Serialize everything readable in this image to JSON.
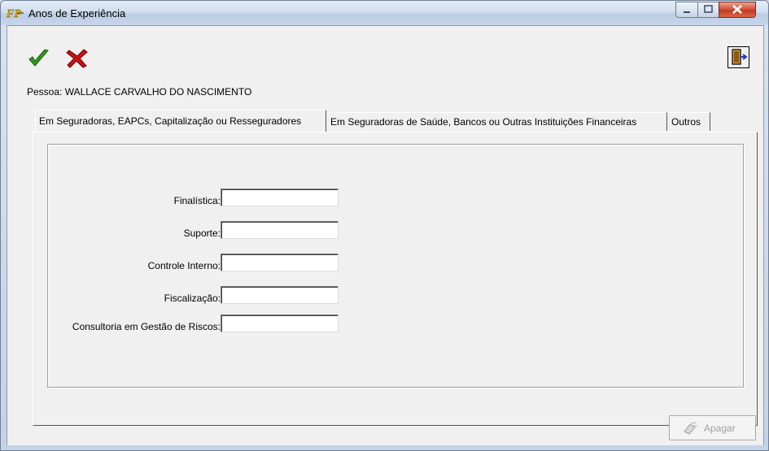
{
  "window": {
    "title": "Anos de Experiência",
    "app_icon": "fp-logo-icon",
    "controls": [
      "minimize-icon",
      "maximize-icon",
      "close-icon"
    ]
  },
  "toolbar": {
    "confirm_icon": "checkmark-icon",
    "cancel_icon": "red-x-icon",
    "exit_icon": "exit-door-icon"
  },
  "person": {
    "text": "Pessoa: WALLACE CARVALHO DO NASCIMENTO"
  },
  "tabs": [
    {
      "label": "Em Seguradoras, EAPCs, Capitalização ou Resseguradores",
      "active": true
    },
    {
      "label": "Em Seguradoras de Saúde, Bancos ou Outras Instituições Financeiras",
      "active": false
    },
    {
      "label": "Outros",
      "active": false
    }
  ],
  "fields": [
    {
      "label": "Finalística:",
      "value": ""
    },
    {
      "label": "Suporte:",
      "value": ""
    },
    {
      "label": "Controle Interno:",
      "value": ""
    },
    {
      "label": "Fiscalização:",
      "value": ""
    },
    {
      "label": "Consultoria em Gestão de Riscos:",
      "value": ""
    }
  ],
  "footer": {
    "delete_label": "Apagar",
    "delete_icon": "eraser-icon",
    "delete_enabled": false
  },
  "colors": {
    "titlebar": "#c7d6ea",
    "client_bg": "#f0f0f0",
    "close_button": "#c13a22",
    "confirm_check": "#2e9a1e",
    "cancel_x": "#cc1111"
  }
}
